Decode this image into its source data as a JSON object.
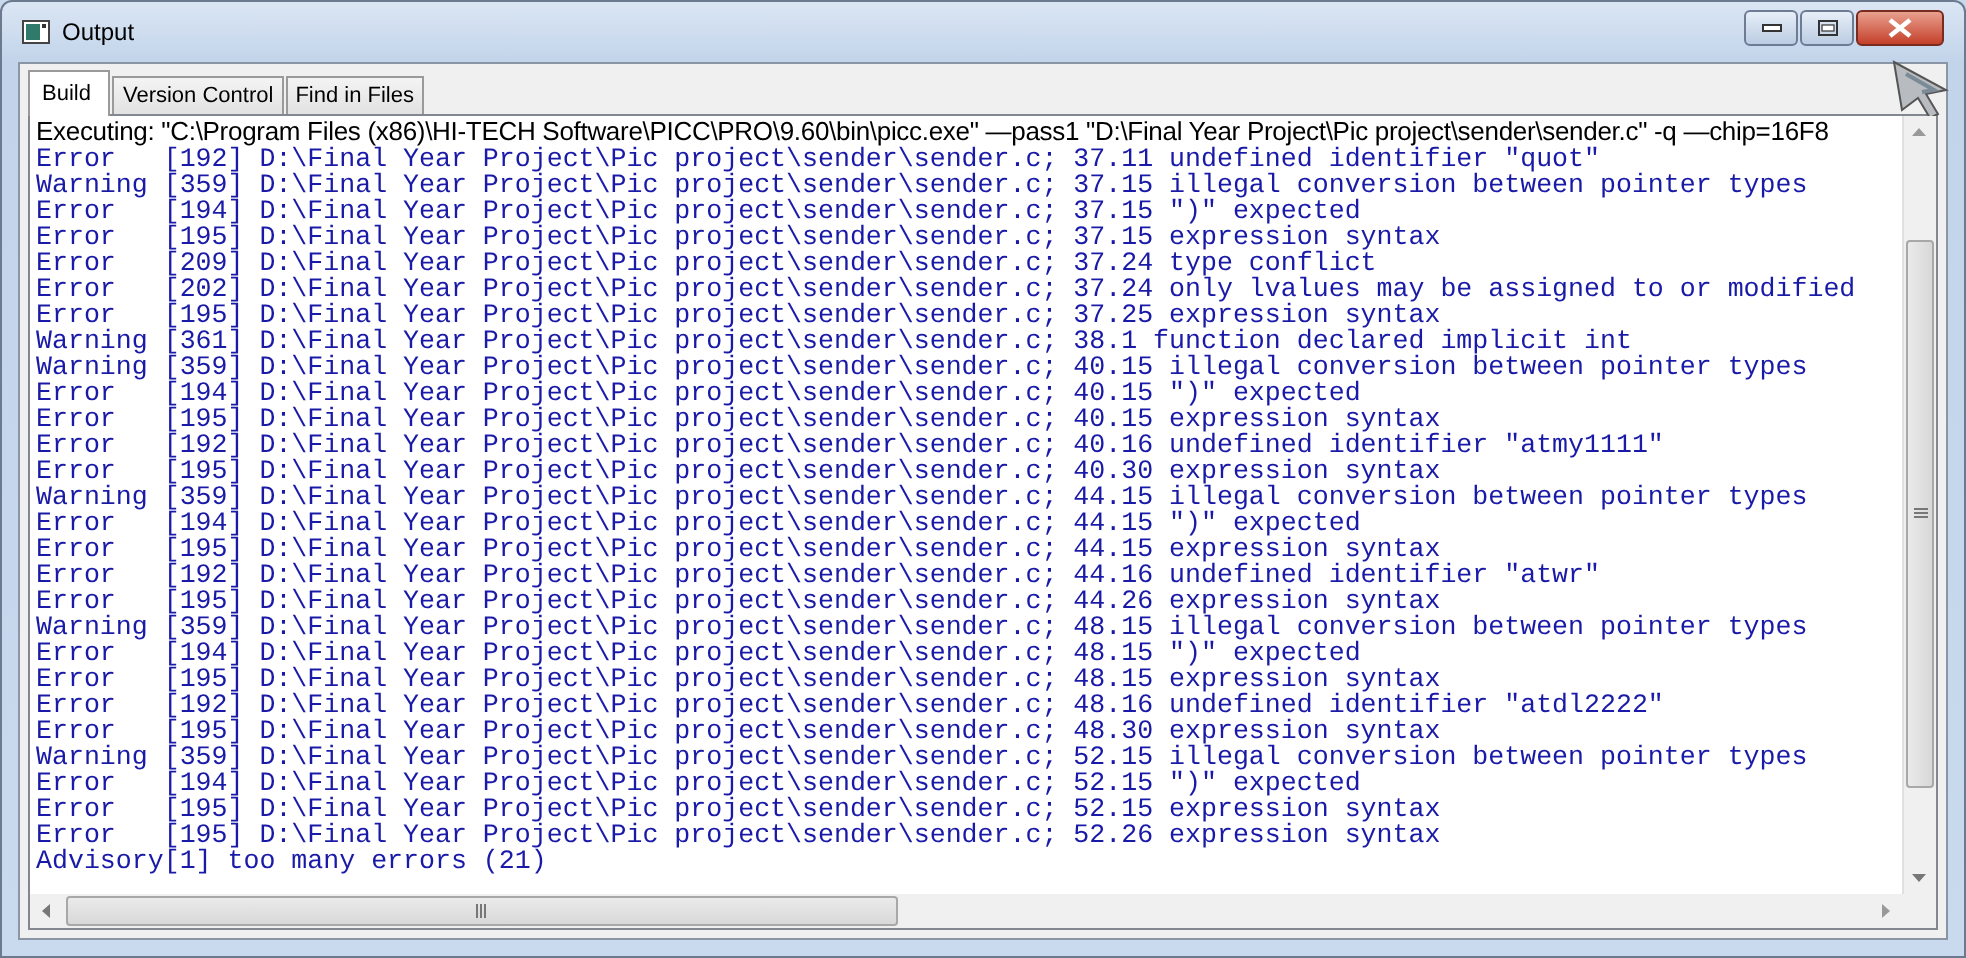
{
  "window": {
    "title": "Output"
  },
  "tabs": [
    {
      "label": "Build",
      "selected": true
    },
    {
      "label": "Version Control",
      "selected": false
    },
    {
      "label": "Find in Files",
      "selected": false
    }
  ],
  "output": {
    "command": "Executing: \"C:\\Program Files (x86)\\HI-TECH Software\\PICC\\PRO\\9.60\\bin\\picc.exe\" —pass1 \"D:\\Final Year Project\\Pic project\\sender\\sender.c\" -q —chip=16F8",
    "lines": [
      "Error   [192] D:\\Final Year Project\\Pic project\\sender\\sender.c; 37.11 undefined identifier \"quot\"",
      "Warning [359] D:\\Final Year Project\\Pic project\\sender\\sender.c; 37.15 illegal conversion between pointer types",
      "Error   [194] D:\\Final Year Project\\Pic project\\sender\\sender.c; 37.15 \")\" expected",
      "Error   [195] D:\\Final Year Project\\Pic project\\sender\\sender.c; 37.15 expression syntax",
      "Error   [209] D:\\Final Year Project\\Pic project\\sender\\sender.c; 37.24 type conflict",
      "Error   [202] D:\\Final Year Project\\Pic project\\sender\\sender.c; 37.24 only lvalues may be assigned to or modified",
      "Error   [195] D:\\Final Year Project\\Pic project\\sender\\sender.c; 37.25 expression syntax",
      "Warning [361] D:\\Final Year Project\\Pic project\\sender\\sender.c; 38.1 function declared implicit int",
      "Warning [359] D:\\Final Year Project\\Pic project\\sender\\sender.c; 40.15 illegal conversion between pointer types",
      "Error   [194] D:\\Final Year Project\\Pic project\\sender\\sender.c; 40.15 \")\" expected",
      "Error   [195] D:\\Final Year Project\\Pic project\\sender\\sender.c; 40.15 expression syntax",
      "Error   [192] D:\\Final Year Project\\Pic project\\sender\\sender.c; 40.16 undefined identifier \"atmy1111\"",
      "Error   [195] D:\\Final Year Project\\Pic project\\sender\\sender.c; 40.30 expression syntax",
      "Warning [359] D:\\Final Year Project\\Pic project\\sender\\sender.c; 44.15 illegal conversion between pointer types",
      "Error   [194] D:\\Final Year Project\\Pic project\\sender\\sender.c; 44.15 \")\" expected",
      "Error   [195] D:\\Final Year Project\\Pic project\\sender\\sender.c; 44.15 expression syntax",
      "Error   [192] D:\\Final Year Project\\Pic project\\sender\\sender.c; 44.16 undefined identifier \"atwr\"",
      "Error   [195] D:\\Final Year Project\\Pic project\\sender\\sender.c; 44.26 expression syntax",
      "Warning [359] D:\\Final Year Project\\Pic project\\sender\\sender.c; 48.15 illegal conversion between pointer types",
      "Error   [194] D:\\Final Year Project\\Pic project\\sender\\sender.c; 48.15 \")\" expected",
      "Error   [195] D:\\Final Year Project\\Pic project\\sender\\sender.c; 48.15 expression syntax",
      "Error   [192] D:\\Final Year Project\\Pic project\\sender\\sender.c; 48.16 undefined identifier \"atdl2222\"",
      "Error   [195] D:\\Final Year Project\\Pic project\\sender\\sender.c; 48.30 expression syntax",
      "Warning [359] D:\\Final Year Project\\Pic project\\sender\\sender.c; 52.15 illegal conversion between pointer types",
      "Error   [194] D:\\Final Year Project\\Pic project\\sender\\sender.c; 52.15 \")\" expected",
      "Error   [195] D:\\Final Year Project\\Pic project\\sender\\sender.c; 52.15 expression syntax",
      "Error   [195] D:\\Final Year Project\\Pic project\\sender\\sender.c; 52.26 expression syntax",
      "Advisory[1] too many errors (21)"
    ]
  }
}
